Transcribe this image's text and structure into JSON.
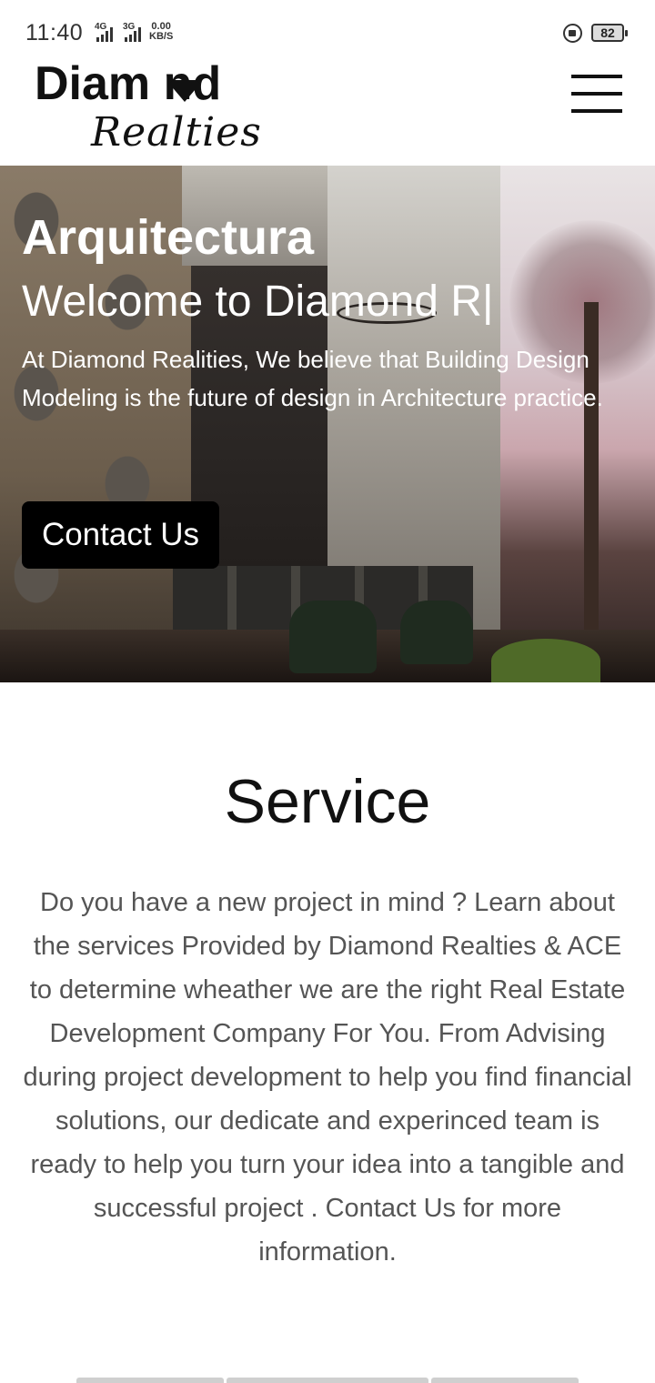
{
  "status_bar": {
    "time": "11:40",
    "network1": "4G",
    "network2": "3G",
    "speed_value": "0.00",
    "speed_unit": "KB/S",
    "battery": "82",
    "icons": [
      "signal-icon",
      "screen-rotation-lock-icon",
      "battery-icon"
    ]
  },
  "header": {
    "logo_top": "Diam nd",
    "logo_bottom": "Realties",
    "menu_icon": "hamburger-menu-icon"
  },
  "hero": {
    "title": "Arquitectura",
    "subtitle": "Welcome to Diamond R|",
    "description": "At Diamond Realities, We believe that Building Design Modeling is the future of design in Architecture practice.",
    "cta_label": "Contact Us"
  },
  "service": {
    "title": "Service",
    "description": "Do you have a new project in mind ? Learn about the services Provided by Diamond Realties & ACE to determine wheather we are the right Real Estate Development Company For You. From Advising during project development to help you find financial solutions, our dedicate and experinced team is ready to help you turn your idea into a tangible and successful project . Contact Us for more information."
  }
}
